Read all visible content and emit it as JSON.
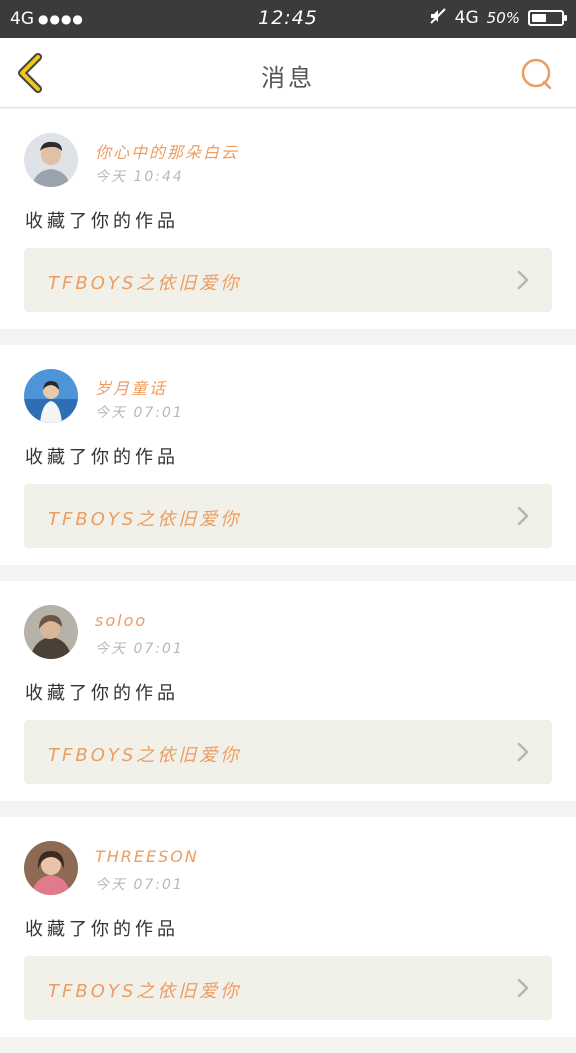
{
  "status_bar": {
    "left_network": "4G",
    "signal_dots": "●●●●",
    "time": "12:45",
    "right_network": "4G",
    "battery_percent": "50%",
    "battery_level": 0.5
  },
  "header": {
    "title": "消息",
    "back_icon": "chevron-left-icon",
    "search_icon": "search-icon"
  },
  "colors": {
    "accent": "#ec9d62",
    "back_icon": "#f5c518",
    "card_box": "#f1f1ea"
  },
  "messages": [
    {
      "username": "你心中的那朵白云",
      "time": "今天 10:44",
      "action": "收藏了你的作品",
      "work_title": "TFBOYS之依旧爱你",
      "avatar": "avatar-photo"
    },
    {
      "username": "岁月童话",
      "time": "今天 07:01",
      "action": "收藏了你的作品",
      "work_title": "TFBOYS之依旧爱你",
      "avatar": "avatar-photo"
    },
    {
      "username": "soloo",
      "time": "今天 07:01",
      "action": "收藏了你的作品",
      "work_title": "TFBOYS之依旧爱你",
      "avatar": "avatar-photo"
    },
    {
      "username": "THREESON",
      "time": "今天 07:01",
      "action": "收藏了你的作品",
      "work_title": "TFBOYS之依旧爱你",
      "avatar": "avatar-photo"
    }
  ]
}
